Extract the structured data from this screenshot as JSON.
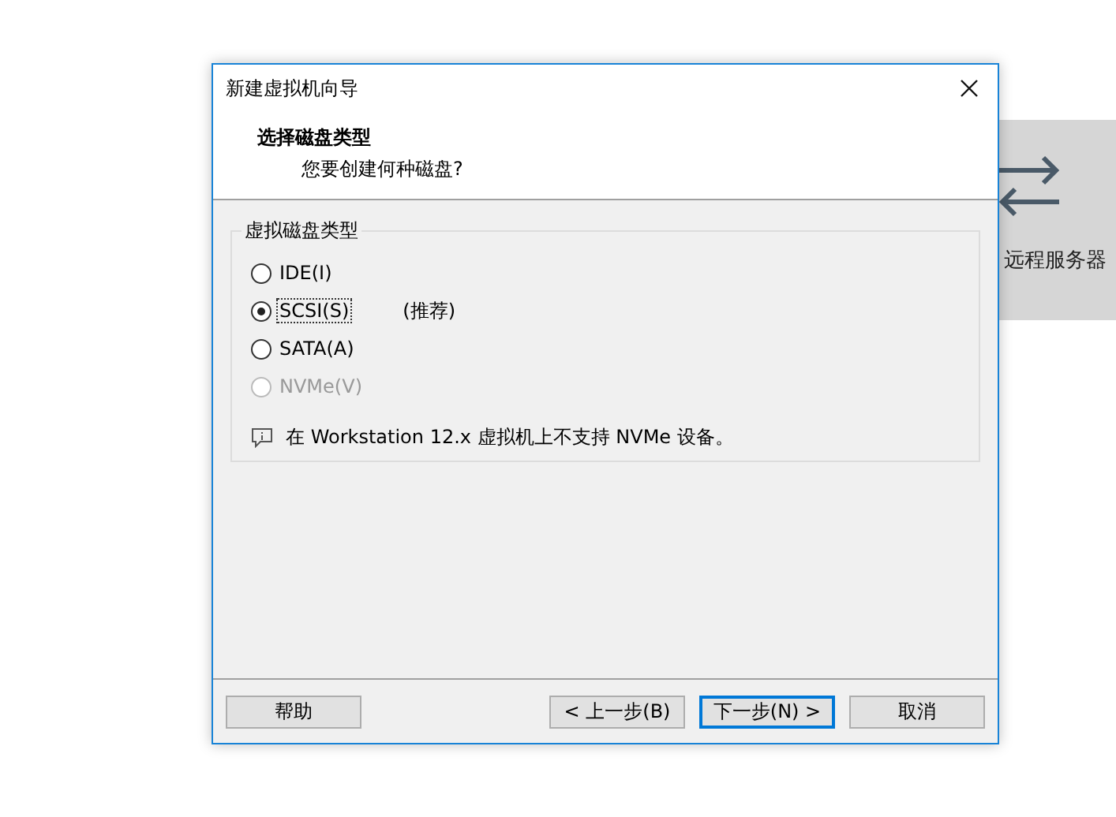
{
  "app": {
    "tile": {
      "label": "远程服务器"
    }
  },
  "dialog": {
    "title": "新建虚拟机向导",
    "heading": "选择磁盘类型",
    "subheading": "您要创建何种磁盘?",
    "group": {
      "title": "虚拟磁盘类型",
      "options": [
        {
          "label": "IDE(I)",
          "selected": false,
          "disabled": false,
          "focused": false
        },
        {
          "label": "SCSI(S)",
          "selected": true,
          "disabled": false,
          "focused": true,
          "note": "(推荐)"
        },
        {
          "label": "SATA(A)",
          "selected": false,
          "disabled": false,
          "focused": false
        },
        {
          "label": "NVMe(V)",
          "selected": false,
          "disabled": true,
          "focused": false
        }
      ],
      "info": "在 Workstation 12.x 虚拟机上不支持 NVMe 设备。"
    },
    "buttons": [
      {
        "label": "帮助",
        "default": false
      },
      {
        "label": "< 上一步(B)",
        "default": false
      },
      {
        "label": "下一步(N) >",
        "default": true
      },
      {
        "label": "取消",
        "default": false
      }
    ]
  }
}
